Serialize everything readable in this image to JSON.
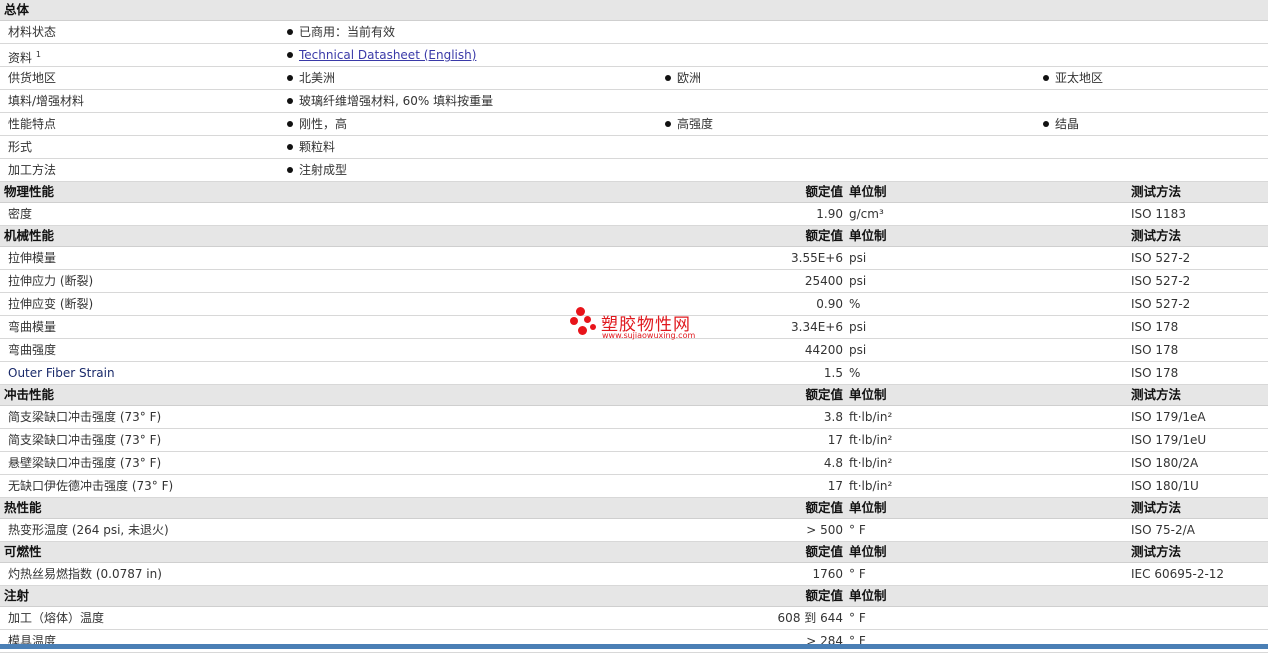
{
  "general": {
    "title": "总体",
    "status_label": "材料状态",
    "status_value": "已商用：当前有效",
    "docs_label": "资料",
    "docs_sup": "1",
    "docs_link": "Technical Datasheet (English)",
    "supply_label": "供货地区",
    "supply": [
      "北美洲",
      "欧洲",
      "亚太地区"
    ],
    "filler_label": "填料/增强材料",
    "filler_value": "玻璃纤维增强材料, 60% 填料按重量",
    "features_label": "性能特点",
    "features": [
      "刚性，高",
      "高强度",
      "结晶"
    ],
    "form_label": "形式",
    "form_value": "颗粒料",
    "process_label": "加工方法",
    "process_value": "注射成型"
  },
  "headers": {
    "value": "额定值",
    "unit": "单位制",
    "test": "测试方法"
  },
  "physical": {
    "title": "物理性能",
    "rows": [
      {
        "name": "密度",
        "value": "1.90",
        "unit": "g/cm³",
        "test": "ISO 1183"
      }
    ]
  },
  "mechanical": {
    "title": "机械性能",
    "rows": [
      {
        "name": "拉伸模量",
        "value": "3.55E+6",
        "unit": "psi",
        "test": "ISO 527-2"
      },
      {
        "name": "拉伸应力 (断裂)",
        "value": "25400",
        "unit": "psi",
        "test": "ISO 527-2"
      },
      {
        "name": "拉伸应变 (断裂)",
        "value": "0.90",
        "unit": "%",
        "test": "ISO 527-2"
      },
      {
        "name": "弯曲模量",
        "value": "3.34E+6",
        "unit": "psi",
        "test": "ISO 178"
      },
      {
        "name": "弯曲强度",
        "value": "44200",
        "unit": "psi",
        "test": "ISO 178"
      },
      {
        "name": "Outer Fiber Strain",
        "value": "1.5",
        "unit": "%",
        "test": "ISO 178"
      }
    ]
  },
  "impact": {
    "title": "冲击性能",
    "rows": [
      {
        "name": "简支梁缺口冲击强度 (73° F)",
        "value": "3.8",
        "unit": "ft·lb/in²",
        "test": "ISO 179/1eA"
      },
      {
        "name": "简支梁缺口冲击强度 (73° F)",
        "value": "17",
        "unit": "ft·lb/in²",
        "test": "ISO 179/1eU"
      },
      {
        "name": "悬壁梁缺口冲击强度 (73° F)",
        "value": "4.8",
        "unit": "ft·lb/in²",
        "test": "ISO 180/2A"
      },
      {
        "name": "无缺口伊佐德冲击强度 (73° F)",
        "value": "17",
        "unit": "ft·lb/in²",
        "test": "ISO 180/1U"
      }
    ]
  },
  "thermal": {
    "title": "热性能",
    "rows": [
      {
        "name": "热变形温度 (264 psi, 未退火)",
        "value": "> 500",
        "unit": "° F",
        "test": "ISO 75-2/A"
      }
    ]
  },
  "flammability": {
    "title": "可燃性",
    "rows": [
      {
        "name": "灼热丝易燃指数 (0.0787 in)",
        "value": "1760",
        "unit": "° F",
        "test": "IEC 60695-2-12"
      }
    ]
  },
  "injection": {
    "title": "注射",
    "rows": [
      {
        "name": "加工（熔体）温度",
        "value": "608 到 644",
        "unit": "° F"
      },
      {
        "name": "模具温度",
        "value": "> 284",
        "unit": "° F"
      }
    ]
  },
  "watermark": {
    "name": "塑胶物性网",
    "url": "www.sujiaowuxing.com"
  }
}
